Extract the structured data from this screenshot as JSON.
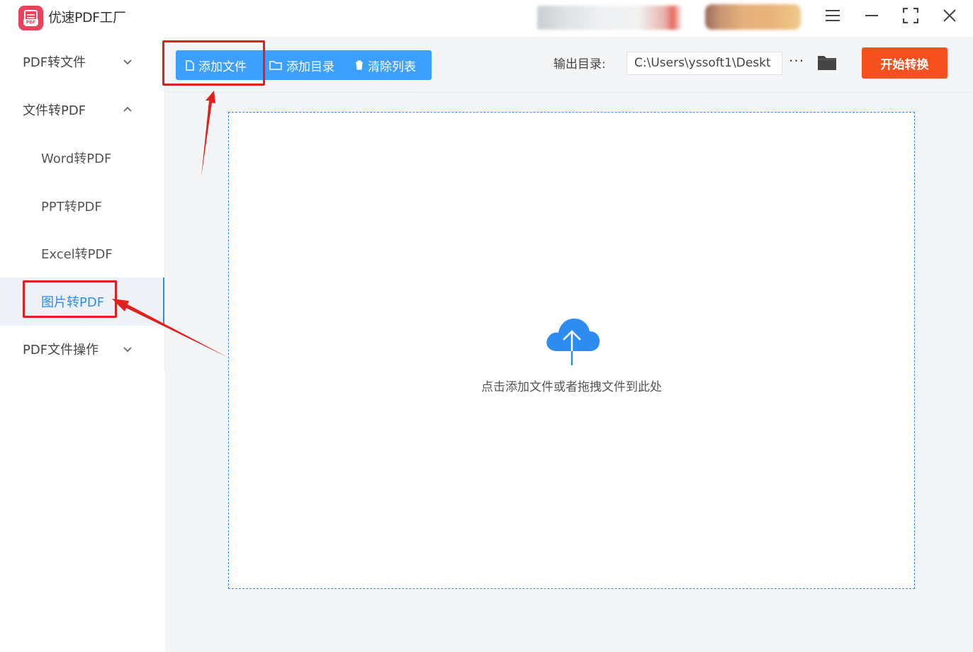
{
  "app": {
    "title": "优速PDF工厂"
  },
  "sidebar": {
    "groups": [
      {
        "label": "PDF转文件",
        "expanded": false
      },
      {
        "label": "文件转PDF",
        "expanded": true
      },
      {
        "label": "PDF文件操作",
        "expanded": false
      }
    ],
    "items": [
      {
        "label": "Word转PDF"
      },
      {
        "label": "PPT转PDF"
      },
      {
        "label": "Excel转PDF"
      },
      {
        "label": "图片转PDF",
        "active": true
      }
    ]
  },
  "toolbar": {
    "add_file_label": "添加文件",
    "add_dir_label": "添加目录",
    "clear_list_label": "清除列表",
    "output_label": "输出目录:",
    "output_path": "C:\\Users\\yssoft1\\Deskt",
    "more_label": "···",
    "start_label": "开始转换"
  },
  "dropzone": {
    "hint": "点击添加文件或者拖拽文件到此处"
  },
  "colors": {
    "accent": "#2d8cf0",
    "button_blue": "#3d9fff",
    "start_orange": "#f5501e",
    "annotation_red": "#e0201c",
    "logo_pink": "#e8435c"
  },
  "icons": [
    "pdf-logo-icon",
    "menu-icon",
    "minimize-icon",
    "maximize-icon",
    "close-icon",
    "chevron-down-icon",
    "chevron-up-icon",
    "file-icon",
    "folder-outline-icon",
    "trash-icon",
    "folder-icon",
    "cloud-upload-icon"
  ]
}
